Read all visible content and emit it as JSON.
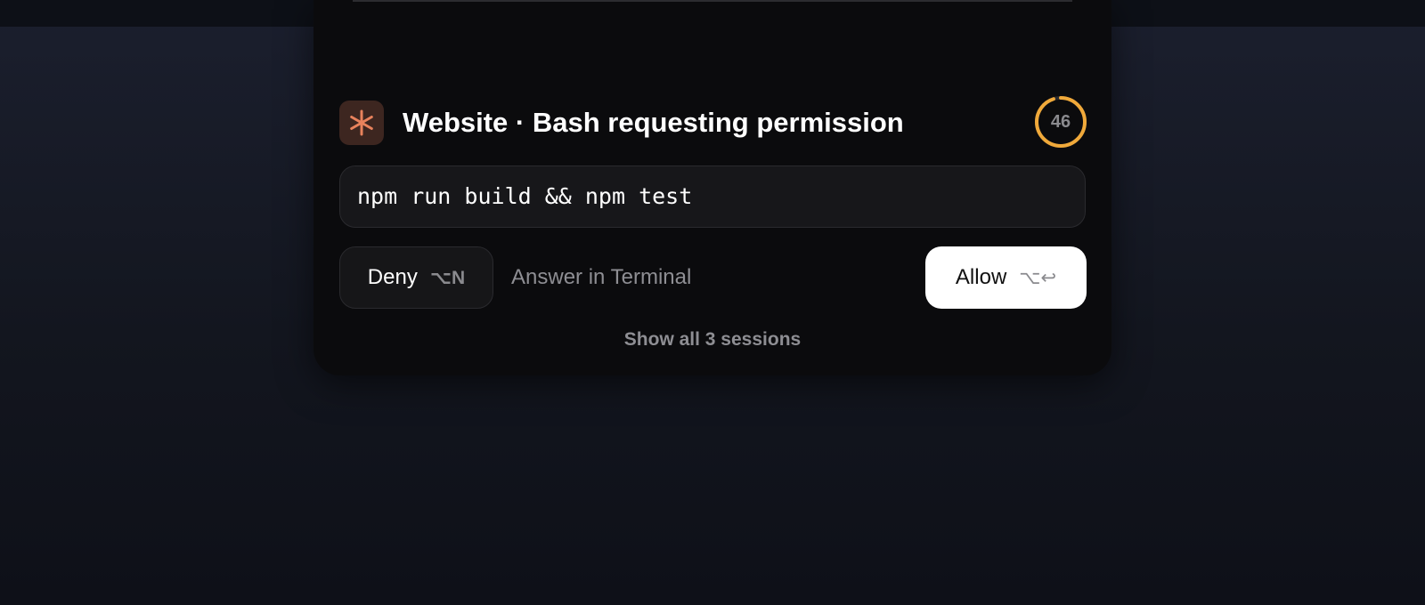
{
  "notification": {
    "title": "Website · Bash requesting permission",
    "app_icon": "asterisk-icon",
    "countdown": 46,
    "countdown_fraction": 0.95,
    "command": "npm run build && npm test",
    "deny": {
      "label": "Deny",
      "shortcut": "⌥N"
    },
    "answer_terminal": "Answer in Terminal",
    "allow": {
      "label": "Allow",
      "shortcut": "⌥↩"
    },
    "show_all": "Show all 3 sessions"
  },
  "colors": {
    "accent_orange": "#e8825c",
    "countdown_ring": "#f0a93a",
    "panel_bg": "#0b0b0d",
    "allow_bg": "#ffffff"
  }
}
